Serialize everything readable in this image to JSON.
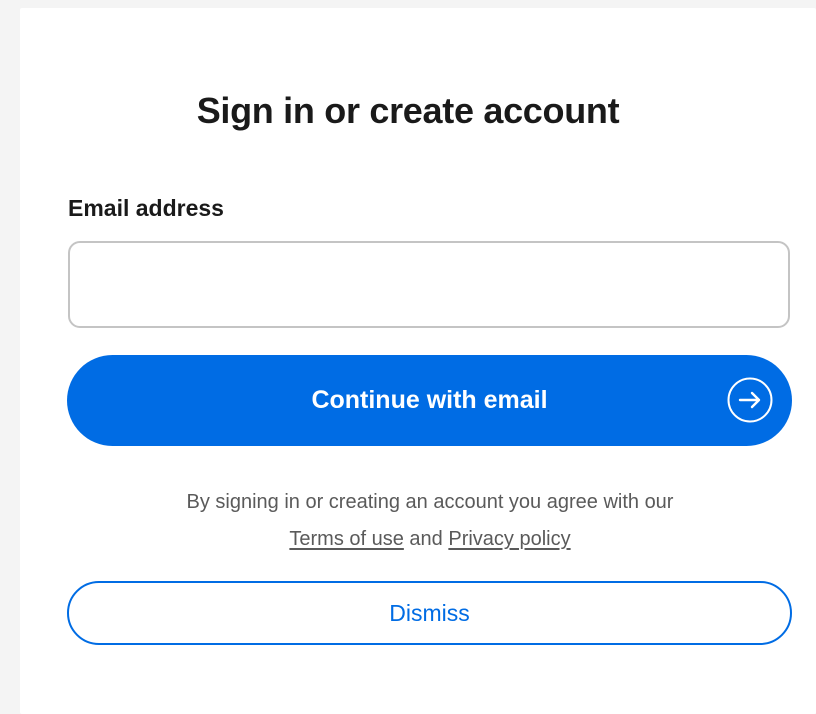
{
  "dialog": {
    "title": "Sign in or create account",
    "email": {
      "label": "Email address",
      "value": "",
      "placeholder": ""
    },
    "continue_button": {
      "label": "Continue with email",
      "icon": "arrow-right-circle-icon"
    },
    "legal": {
      "prefix": "By signing in or creating an account you agree with our",
      "terms_link": "Terms of use",
      "conjunction": "and",
      "privacy_link": "Privacy policy"
    },
    "dismiss_button": {
      "label": "Dismiss"
    }
  },
  "colors": {
    "primary": "#006ce4",
    "text": "#1a1a1a",
    "muted_text": "#5a5a5a",
    "input_border": "#c4c4c4",
    "background": "#f4f4f4",
    "card": "#ffffff"
  }
}
